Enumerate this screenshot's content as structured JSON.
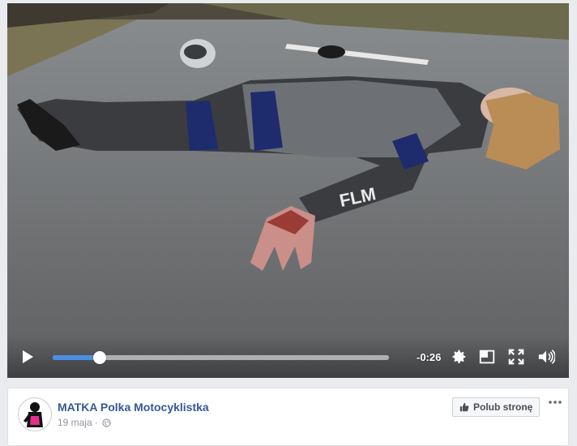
{
  "video": {
    "time_remaining": "-0:26",
    "progress": 0.14
  },
  "post": {
    "page_name": "MATKA Polka Motocyklistka",
    "date": "19 maja",
    "separator": "·",
    "like_button_label": "Polub stronę"
  },
  "icons": {
    "play": "play-icon",
    "settings": "gear-icon",
    "pip": "picture-in-picture-icon",
    "fullscreen": "fullscreen-icon",
    "volume": "volume-icon",
    "globe": "globe-icon",
    "like": "thumbs-up-icon",
    "more": "more-options-icon"
  },
  "colors": {
    "progress": "#4a90e2",
    "link": "#365899"
  }
}
